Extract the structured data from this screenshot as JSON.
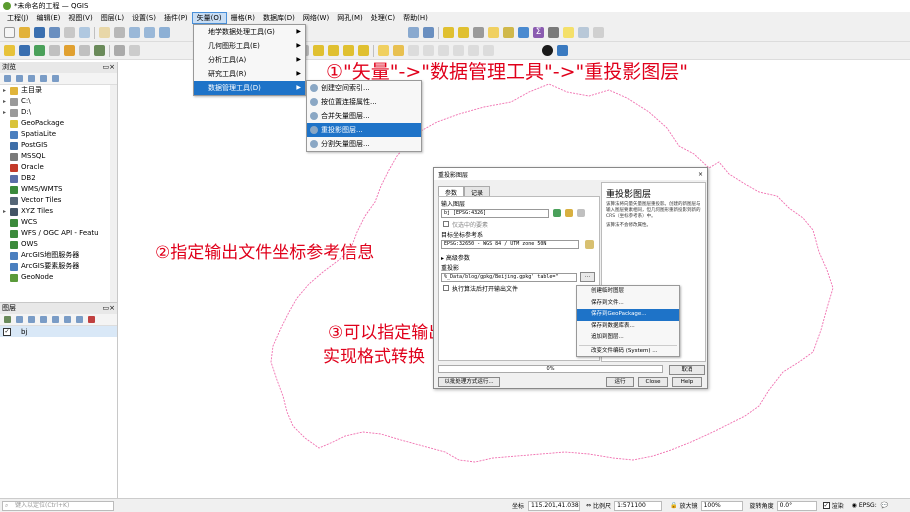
{
  "window": {
    "title": "*未命名的工程 — QGIS"
  },
  "menubar": [
    {
      "label": "工程(J)"
    },
    {
      "label": "编辑(E)"
    },
    {
      "label": "视图(V)"
    },
    {
      "label": "图层(L)"
    },
    {
      "label": "设置(S)"
    },
    {
      "label": "插件(P)"
    },
    {
      "label": "矢量(O)",
      "active": true
    },
    {
      "label": "栅格(R)"
    },
    {
      "label": "数据库(D)"
    },
    {
      "label": "网络(W)"
    },
    {
      "label": "网孔(M)"
    },
    {
      "label": "处理(C)"
    },
    {
      "label": "帮助(H)"
    }
  ],
  "vector_menu": {
    "items": [
      {
        "label": "地学数据处理工具(G)"
      },
      {
        "label": "几何图形工具(E)"
      },
      {
        "label": "分析工具(A)"
      },
      {
        "label": "研究工具(R)"
      },
      {
        "label": "数据管理工具(D)"
      }
    ]
  },
  "data_mgmt_menu": {
    "items": [
      {
        "label": "创建空间索引..."
      },
      {
        "label": "按位置连接属性..."
      },
      {
        "label": "合并矢量图层..."
      },
      {
        "label": "重投影图层..."
      },
      {
        "label": "分割矢量图层..."
      }
    ]
  },
  "browser": {
    "title": "浏览",
    "items": [
      {
        "label": "主目录",
        "icon": "home-folder-icon",
        "color": "#e0b43a"
      },
      {
        "label": "C:\\",
        "icon": "drive-icon",
        "color": "#9a9a9a"
      },
      {
        "label": "D:\\",
        "icon": "drive-icon",
        "color": "#9a9a9a"
      },
      {
        "label": "GeoPackage",
        "icon": "geopackage-icon",
        "color": "#d9c33a"
      },
      {
        "label": "SpatiaLite",
        "icon": "spatialite-icon",
        "color": "#4a7fbf"
      },
      {
        "label": "PostGIS",
        "icon": "postgis-icon",
        "color": "#3d6ea8"
      },
      {
        "label": "MSSQL",
        "icon": "mssql-icon",
        "color": "#7a7a7a"
      },
      {
        "label": "Oracle",
        "icon": "oracle-icon",
        "color": "#c43a2a"
      },
      {
        "label": "DB2",
        "icon": "db2-icon",
        "color": "#5b6ea8"
      },
      {
        "label": "WMS/WMTS",
        "icon": "globe-icon",
        "color": "#3b8a3b"
      },
      {
        "label": "Vector Tiles",
        "icon": "vector-tiles-icon",
        "color": "#556677"
      },
      {
        "label": "XYZ Tiles",
        "icon": "xyz-tiles-icon",
        "color": "#445566"
      },
      {
        "label": "WCS",
        "icon": "globe-icon",
        "color": "#3b8a3b"
      },
      {
        "label": "WFS / OGC API - Featu",
        "icon": "globe-icon",
        "color": "#3b8a3b"
      },
      {
        "label": "OWS",
        "icon": "globe-icon",
        "color": "#3b8a3b"
      },
      {
        "label": "ArcGIS地图服务器",
        "icon": "arcgis-icon",
        "color": "#4a7fbf"
      },
      {
        "label": "ArcGIS要素服务器",
        "icon": "arcgis-icon",
        "color": "#4a7fbf"
      },
      {
        "label": "GeoNode",
        "icon": "geonode-icon",
        "color": "#5a9a3a"
      }
    ]
  },
  "layers": {
    "title": "图层",
    "items": [
      {
        "label": "bj",
        "checked": true
      }
    ]
  },
  "annotations": {
    "a1": "①\"矢量\"->\"数据管理工具\"->\"重投影图层\"",
    "a2": "②指定输出文件坐标参考信息",
    "a3_line1": "③可以指定输出文件的类型,",
    "a3_line2": "实现格式转换"
  },
  "dialog": {
    "title": "重投影图层",
    "tabs": [
      "参数",
      "记录"
    ],
    "input_label": "输入图层",
    "input_value": "bj [EPSG:4326]",
    "selected_only": "仅选中的要素",
    "target_crs_label": "目标坐标参考系",
    "target_crs_value": "EPSG:32650 - WGS 84 / UTM zone 50N",
    "advanced": "高级参数",
    "output_label": "重投影",
    "output_value": "%_Data/blog/gpkg/Beijing.gpkg' table=\"",
    "open_after": "执行算法后打开输出文件",
    "help_title": "重投影图层",
    "help_text": "该算法将向量矢量图层重投影。创建的新图层与输入图层要素相同，但几何图形重新投影到新的 CRS（坐标参考系）中。",
    "help_text2": "该算法不会修改属性。",
    "progress": "0%",
    "cancel": "取消",
    "batch": "以批处理方式运行...",
    "run": "运行",
    "close": "Close",
    "help": "Help"
  },
  "output_menu": {
    "items": [
      {
        "label": "创建临时图层"
      },
      {
        "label": "保存到文件..."
      },
      {
        "label": "保存到GeoPackage..."
      },
      {
        "label": "保存到数据库表..."
      },
      {
        "label": "追加到图层..."
      },
      {
        "label": "改变文件编码 (System) ..."
      }
    ]
  },
  "status": {
    "search_placeholder": "键入以定位(Ctrl+K)",
    "coord_label": "坐标",
    "coord_value": "115.201,41.038",
    "scale_label": "比例尺",
    "scale_value": "1:571100",
    "magnifier_label": "放大镜",
    "magnifier_value": "100%",
    "rotation_label": "旋转角度",
    "rotation_value": "0.0°",
    "render_label": "渲染",
    "crs_value": "EPSG:"
  }
}
